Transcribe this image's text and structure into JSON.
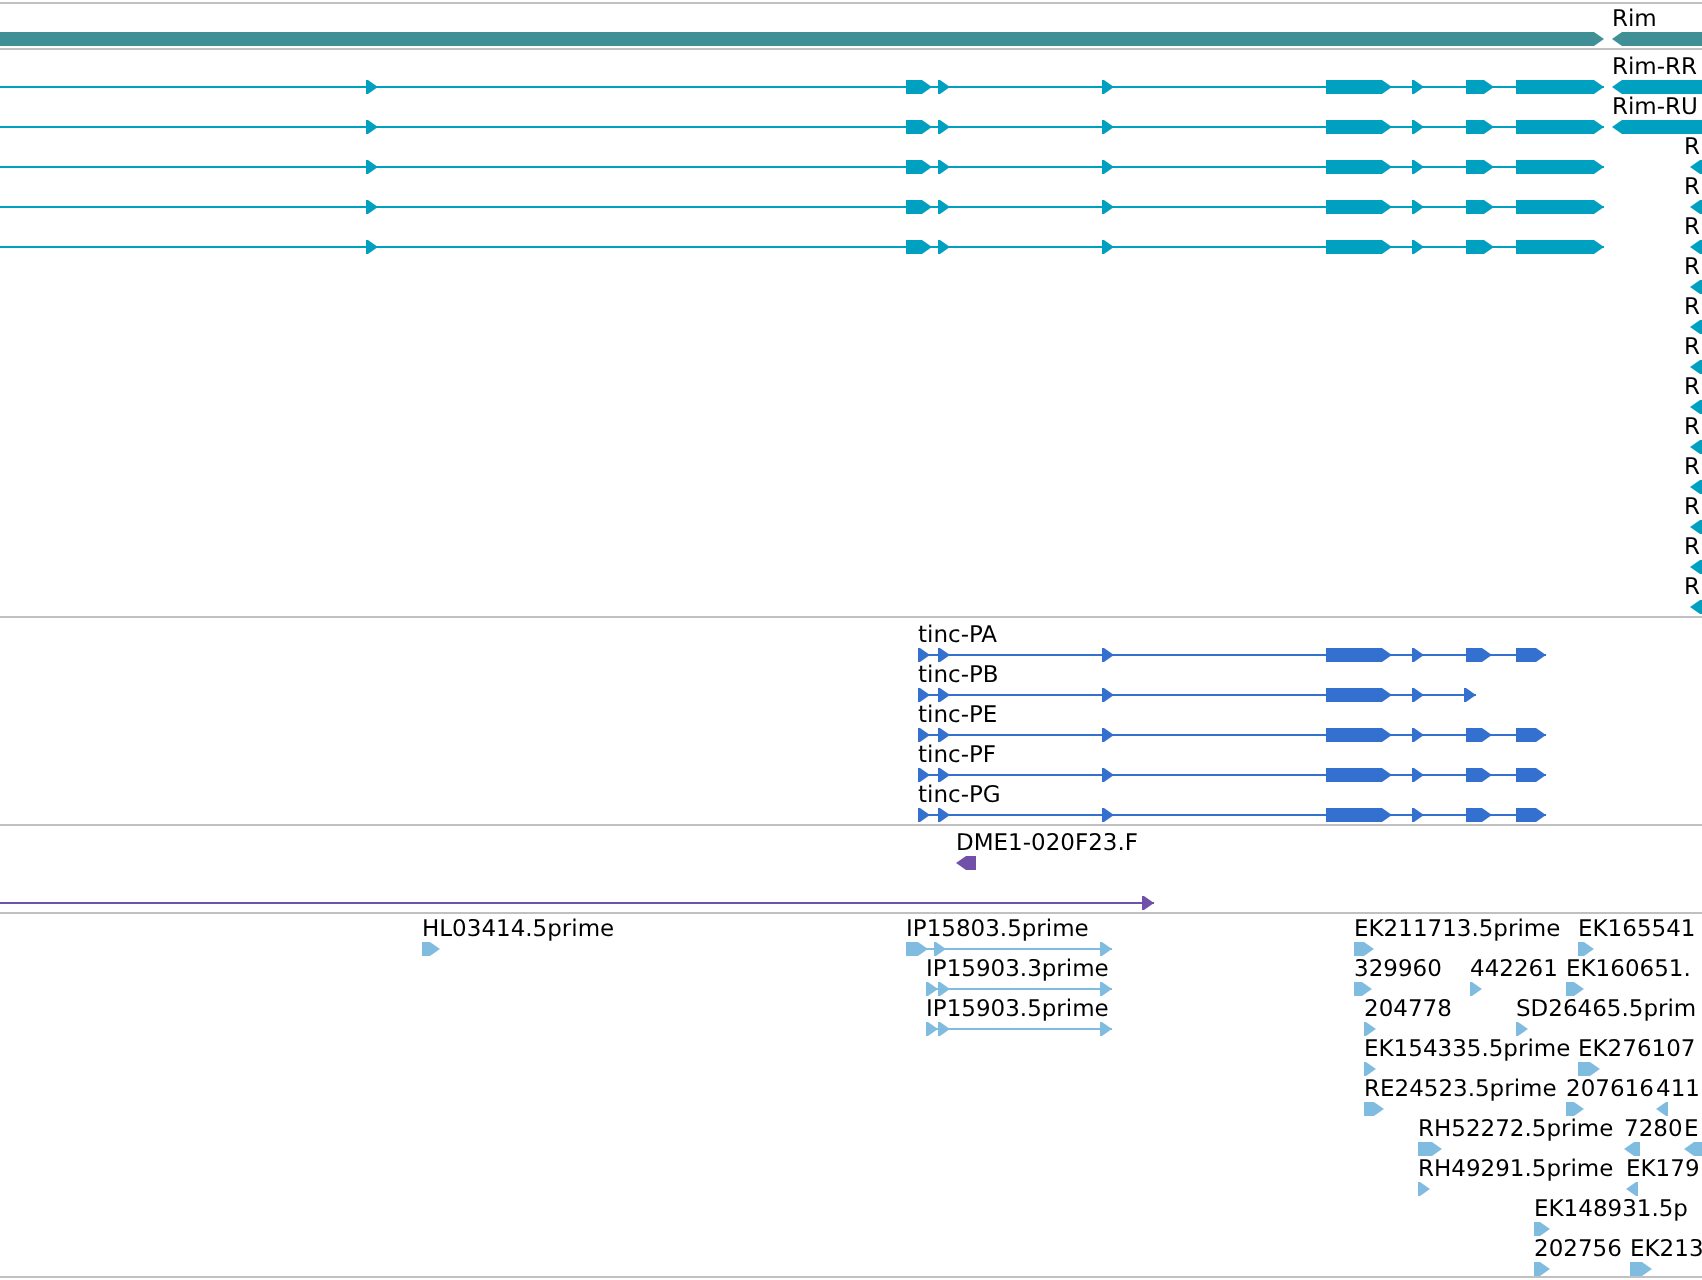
{
  "tracks": [
    {
      "color": "#3f8f94",
      "features": [
        {
          "label": "Rim"
        }
      ]
    },
    {
      "color": "#00a0c0",
      "features": [
        {
          "label": "Rim-RR"
        },
        {
          "label": "Rim-RU"
        },
        {
          "label": "R"
        },
        {
          "label": "R"
        },
        {
          "label": "R"
        },
        {
          "label": "R"
        },
        {
          "label": "R"
        },
        {
          "label": "R"
        },
        {
          "label": "R"
        },
        {
          "label": "R"
        },
        {
          "label": "R"
        },
        {
          "label": "R"
        },
        {
          "label": "R"
        },
        {
          "label": "R"
        }
      ]
    },
    {
      "color": "#3370d0",
      "features": [
        {
          "label": "tinc-PA"
        },
        {
          "label": "tinc-PB"
        },
        {
          "label": "tinc-PE"
        },
        {
          "label": "tinc-PF"
        },
        {
          "label": "tinc-PG"
        }
      ]
    },
    {
      "color": "#7050a8",
      "features": [
        {
          "label": "DME1-020F23.F"
        }
      ]
    },
    {
      "color": "#80bce0",
      "features": [
        {
          "label": "HL03414.5prime"
        },
        {
          "label": "IP15803.5prime"
        },
        {
          "label": "EK211713.5prime"
        },
        {
          "label": "EK165541"
        },
        {
          "label": "IP15903.3prime"
        },
        {
          "label": "329960"
        },
        {
          "label": "442261"
        },
        {
          "label": "EK160651."
        },
        {
          "label": "IP15903.5prime"
        },
        {
          "label": "204778"
        },
        {
          "label": "SD26465.5prim"
        },
        {
          "label": "EK154335.5prime"
        },
        {
          "label": "EK276107"
        },
        {
          "label": "RE24523.5prime"
        },
        {
          "label": "207616"
        },
        {
          "label": "411"
        },
        {
          "label": "RH52272.5prime"
        },
        {
          "label": "7280"
        },
        {
          "label": "E"
        },
        {
          "label": "RH49291.5prime"
        },
        {
          "label": "EK179"
        },
        {
          "label": "EK148931.5p"
        },
        {
          "label": "202756"
        },
        {
          "label": "EK213"
        }
      ]
    }
  ]
}
